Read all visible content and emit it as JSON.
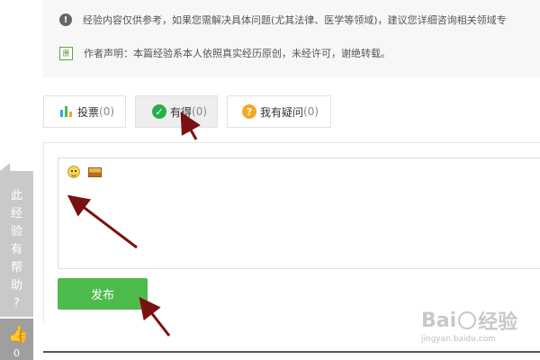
{
  "notice": {
    "disclaimer_icon": "exclamation-icon",
    "disclaimer_text": "经验内容仅供参考，如果您需解决具体问题(尤其法律、医学等领域)，建议您详细咨询相关领域专",
    "author_icon_text": "原",
    "author_text": "作者声明：本篇经验系本人依照真实经历原创，未经许可，谢绝转载。"
  },
  "tabs": [
    {
      "label": "投票",
      "count": "(0)",
      "icon": "bar-chart-icon"
    },
    {
      "label": "有得",
      "count": "(0)",
      "icon": "check-icon",
      "active": true
    },
    {
      "label": "我有疑问",
      "count": "(0)",
      "icon": "question-icon"
    }
  ],
  "editor": {
    "toolbar_icons": [
      "emoji-icon",
      "image-icon"
    ],
    "value": "",
    "publish_label": "发布"
  },
  "side_widget": {
    "text": "此\n经\n验\n有\n帮\n助\n?",
    "thumb_count": "0"
  },
  "watermark": {
    "main_left": "Bai",
    "main_right": "经验",
    "sub": "jingyan.baidu.com"
  },
  "colors": {
    "publish_bg": "#4cbb4c",
    "check_green": "#22b14c",
    "question_orange": "#f5a623",
    "arrow": "#7a1111"
  }
}
